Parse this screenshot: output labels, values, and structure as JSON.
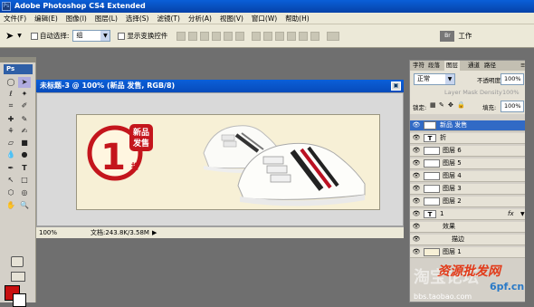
{
  "titlebar": {
    "title": "Adobe Photoshop CS4 Extended",
    "mini": "Ps"
  },
  "menu": [
    "文件(F)",
    "编辑(E)",
    "图像(I)",
    "图层(L)",
    "选择(S)",
    "滤镜(T)",
    "分析(A)",
    "视图(V)",
    "窗口(W)",
    "帮助(H)"
  ],
  "options": {
    "auto_select_label": "自动选择:",
    "auto_select_value": "组",
    "show_transform_label": "显示变换控件",
    "workspace_label": "工作"
  },
  "toolbox": {
    "logo": "Ps"
  },
  "document": {
    "title": "未标题-3 @ 100% (新品 发售, RGB/8)",
    "zoom": "100%",
    "doc_size": "文档:243.8K/3.58M"
  },
  "banner": {
    "badge_line1": "新品",
    "badge_line2": "发售",
    "big_number": "1",
    "suffix": "折"
  },
  "layers_panel": {
    "tabs": [
      "字符",
      "段落",
      "图层",
      "通道",
      "路径"
    ],
    "active_tab": "图层",
    "blend_mode": "正常",
    "opacity_label": "不透明度:",
    "opacity_value": "100%",
    "mask_density_label": "Layer Mask Density",
    "mask_density_value": "100%",
    "lock_label": "锁定:",
    "fill_label": "填充:",
    "fill_value": "100%",
    "layers": [
      {
        "name": "新品 发售",
        "type": "T",
        "selected": true
      },
      {
        "name": "折",
        "type": "T"
      },
      {
        "name": "图层 6",
        "type": "img"
      },
      {
        "name": "图层 5",
        "type": "img"
      },
      {
        "name": "图层 4",
        "type": "img"
      },
      {
        "name": "图层 3",
        "type": "img"
      },
      {
        "name": "图层 2",
        "type": "img"
      },
      {
        "name": "1",
        "type": "T",
        "fx": "fx"
      },
      {
        "name": "效果",
        "type": "sub"
      },
      {
        "name": "描边",
        "type": "sub2"
      },
      {
        "name": "图层 1",
        "type": "img"
      }
    ]
  },
  "watermark": {
    "text": "资源批发网",
    "url": "bbs.taobao.com",
    "brand": "淘宝论坛",
    "site": "6pf.cn"
  }
}
